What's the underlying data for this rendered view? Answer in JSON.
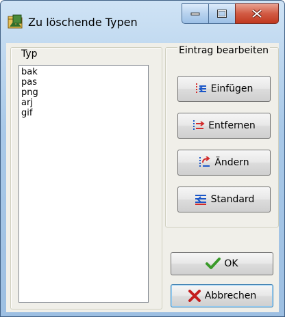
{
  "window": {
    "title": "Zu löschende Typen",
    "app_icon": "folder-icon",
    "controls": {
      "minimize_icon": "minimize-icon",
      "maximize_icon": "maximize-icon",
      "close_icon": "close-icon"
    }
  },
  "types_group": {
    "label": "Typ",
    "items": [
      "bak",
      "pas",
      "png",
      "arj",
      "gif"
    ]
  },
  "edit_group": {
    "label": "Eintrag bearbeiten",
    "buttons": [
      {
        "label": "Einfügen",
        "icon": "insert-icon"
      },
      {
        "label": "Entfernen",
        "icon": "remove-icon"
      },
      {
        "label": "Ändern",
        "icon": "change-icon"
      },
      {
        "label": "Standard",
        "icon": "default-icon"
      }
    ]
  },
  "dialog_buttons": {
    "ok_label": "OK",
    "cancel_label": "Abbrechen"
  },
  "colors": {
    "accent_blue": "#1a56c8",
    "accent_red": "#d22b2b",
    "ok_green": "#3a9a2a"
  }
}
